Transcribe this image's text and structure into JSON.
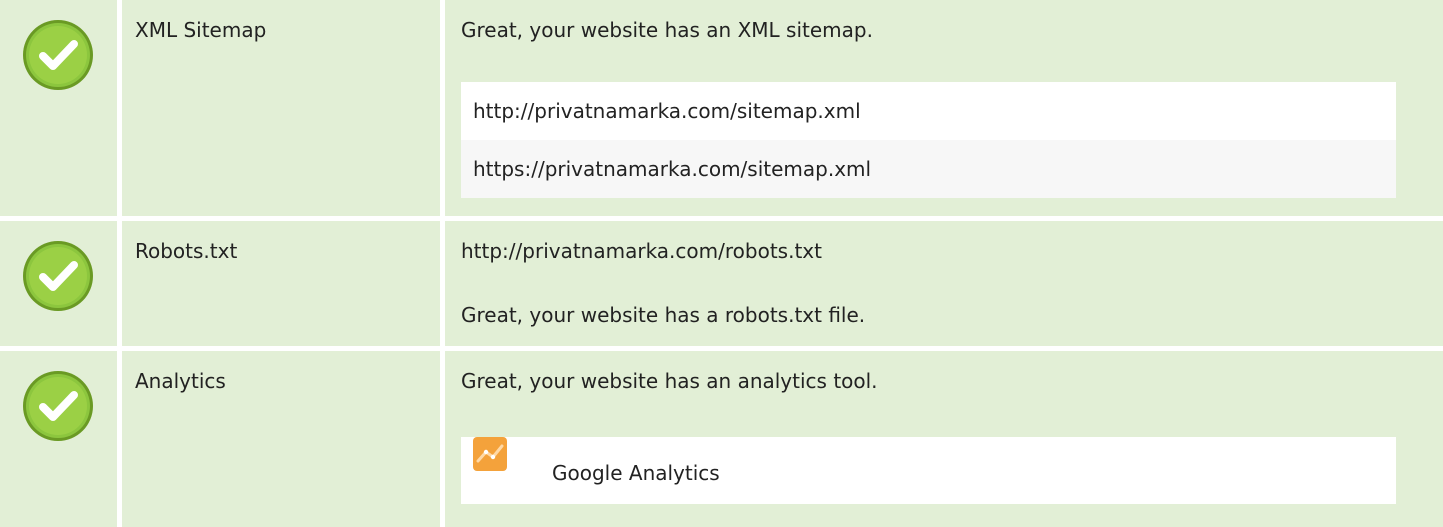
{
  "rows": [
    {
      "status": "passed",
      "status_icon": "check-circle-icon",
      "label": "XML Sitemap",
      "message": "Great, your website has an XML sitemap.",
      "urls": [
        "http://privatnamarka.com/sitemap.xml",
        "https://privatnamarka.com/sitemap.xml"
      ]
    },
    {
      "status": "passed",
      "status_icon": "check-circle-icon",
      "label": "Robots.txt",
      "url": "http://privatnamarka.com/robots.txt",
      "message": "Great, your website has a robots.txt file."
    },
    {
      "status": "passed",
      "status_icon": "check-circle-icon",
      "label": "Analytics",
      "message": "Great, your website has an analytics tool.",
      "tools": [
        {
          "icon": "google-analytics-icon",
          "name": "Google Analytics"
        }
      ]
    }
  ],
  "colors": {
    "row_background": "#e2efd6",
    "check_green": "#8cc63e",
    "check_green_dark": "#6a9a24",
    "analytics_orange": "#f4a23b"
  }
}
